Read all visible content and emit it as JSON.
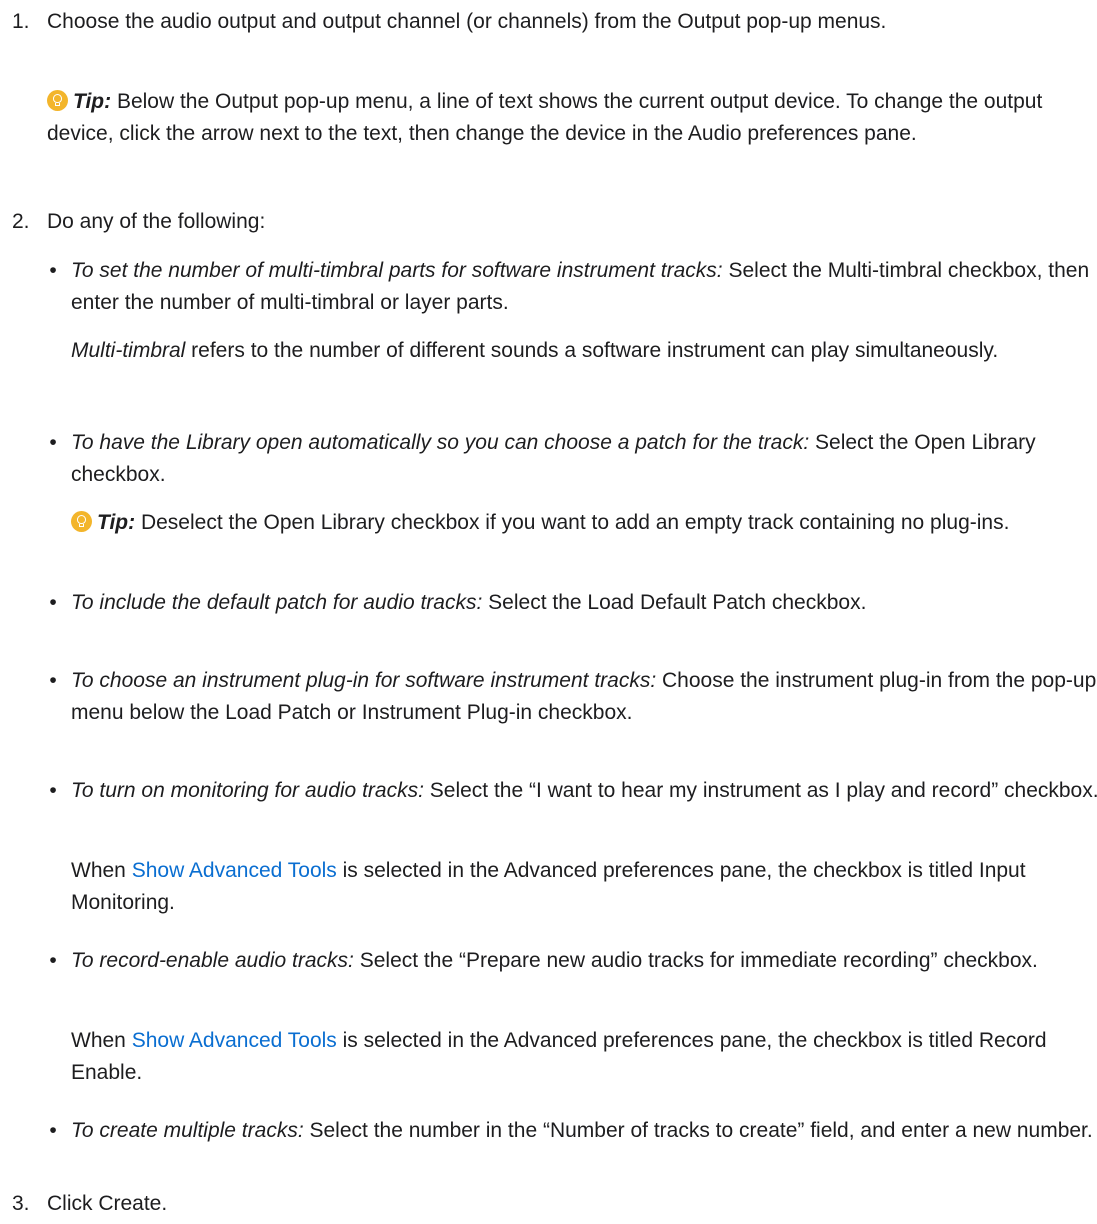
{
  "steps": [
    {
      "number": "1.",
      "text": "Choose the audio output and output channel (or channels) from the Output pop-up menus.",
      "tip": {
        "label": "Tip:",
        "text": " Below the Output pop-up menu, a line of text shows the current output device. To change the output device, click the arrow next to the text, then change the device in the Audio preferences pane."
      }
    },
    {
      "number": "2.",
      "text": "Do any of the following:",
      "bullets": [
        {
          "lead": "To set the number of multi-timbral parts for software instrument tracks:",
          "text": " Select the Multi-timbral checkbox, then enter the number of multi-timbral or layer parts.",
          "note": {
            "lead": "Multi-timbral",
            "text": " refers to the number of different sounds a software instrument can play simultaneously."
          }
        },
        {
          "lead": "To have the Library open automatically so you can choose a patch for the track:",
          "text": " Select the Open Library checkbox.",
          "tip": {
            "label": "Tip:",
            "text": " Deselect the Open Library checkbox if you want to add an empty track containing no plug-ins."
          }
        },
        {
          "lead": "To include the default patch for audio tracks:",
          "text": " Select the Load Default Patch checkbox."
        },
        {
          "lead": "To choose an instrument plug-in for software instrument tracks:",
          "text": " Choose the instrument plug-in from the pop-up menu below the Load Patch or Instrument Plug-in checkbox."
        },
        {
          "lead": "To turn on monitoring for audio tracks:",
          "text": " Select the “I want to hear my instrument as I play and record” checkbox.",
          "note": {
            "before": "When ",
            "link": "Show Advanced Tools",
            "after": " is selected in the Advanced preferences pane, the checkbox is titled Input Monitoring."
          }
        },
        {
          "lead": "To record-enable audio tracks:",
          "text": " Select the “Prepare new audio tracks for immediate recording” checkbox.",
          "note": {
            "before": "When ",
            "link": "Show Advanced Tools",
            "after": " is selected in the Advanced preferences pane, the checkbox is titled Record Enable."
          }
        },
        {
          "lead": "To create multiple tracks:",
          "text": " Select the number in the “Number of tracks to create” field, and enter a new number."
        }
      ]
    },
    {
      "number": "3.",
      "text": "Click Create."
    }
  ],
  "bullet_glyph": "•",
  "colors": {
    "text": "#1d1d1f",
    "link": "#0a6ed1",
    "tip_icon": "#f3b52b"
  },
  "icons": {
    "tip": "lightbulb-icon"
  }
}
